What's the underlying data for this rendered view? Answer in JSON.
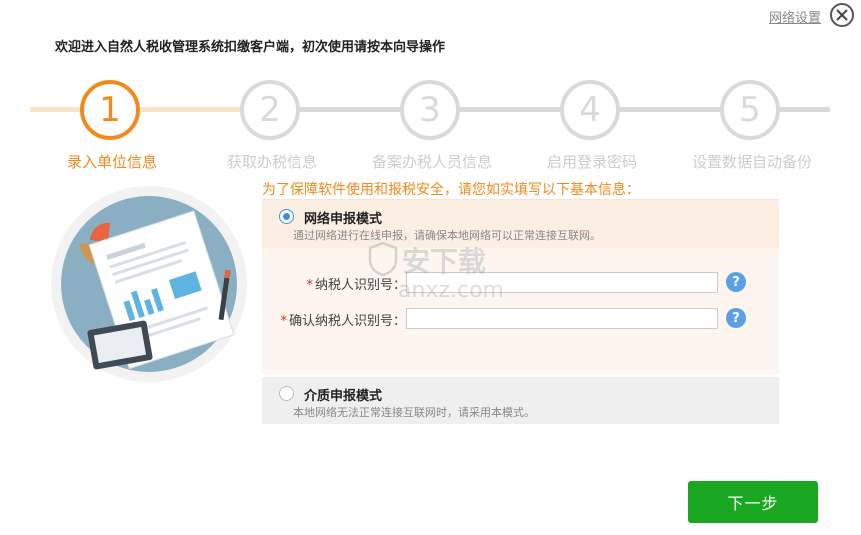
{
  "header": {
    "network_settings": "网络设置",
    "welcome": "欢迎进入自然人税收管理系统扣缴客户端，初次使用请按本向导操作"
  },
  "steps": [
    {
      "number": "1",
      "label": "录入单位信息"
    },
    {
      "number": "2",
      "label": "获取办税信息"
    },
    {
      "number": "3",
      "label": "备案办税人员信息"
    },
    {
      "number": "4",
      "label": "启用登录密码"
    },
    {
      "number": "5",
      "label": "设置数据自动备份"
    }
  ],
  "active_step": 1,
  "form": {
    "notice": "为了保障软件使用和报税安全，请您如实填写以下基本信息：",
    "network_mode": {
      "title": "网络申报模式",
      "desc": "通过网络进行在线申报，请确保本地网络可以正常连接互联网。",
      "selected": true
    },
    "taxpayer_id": {
      "required_mark": "*",
      "label": "纳税人识别号：",
      "value": ""
    },
    "confirm_taxpayer_id": {
      "required_mark": "*",
      "label": "确认纳税人识别号：",
      "value": ""
    },
    "help_icon": "?",
    "media_mode": {
      "title": "介质申报模式",
      "desc": "本地网络无法正常连接互联网时，请采用本模式。",
      "selected": false
    }
  },
  "watermark": {
    "cn": "安下载",
    "en": "anxz.com"
  },
  "next_button": "下一步",
  "colors": {
    "accent_orange": "#f08a1c",
    "inactive_step": "#d9d9d9",
    "next_green": "#19a81f",
    "help_blue": "#5aa0e6"
  },
  "icons": [
    "close-icon",
    "help-icon",
    "document-illustration"
  ]
}
